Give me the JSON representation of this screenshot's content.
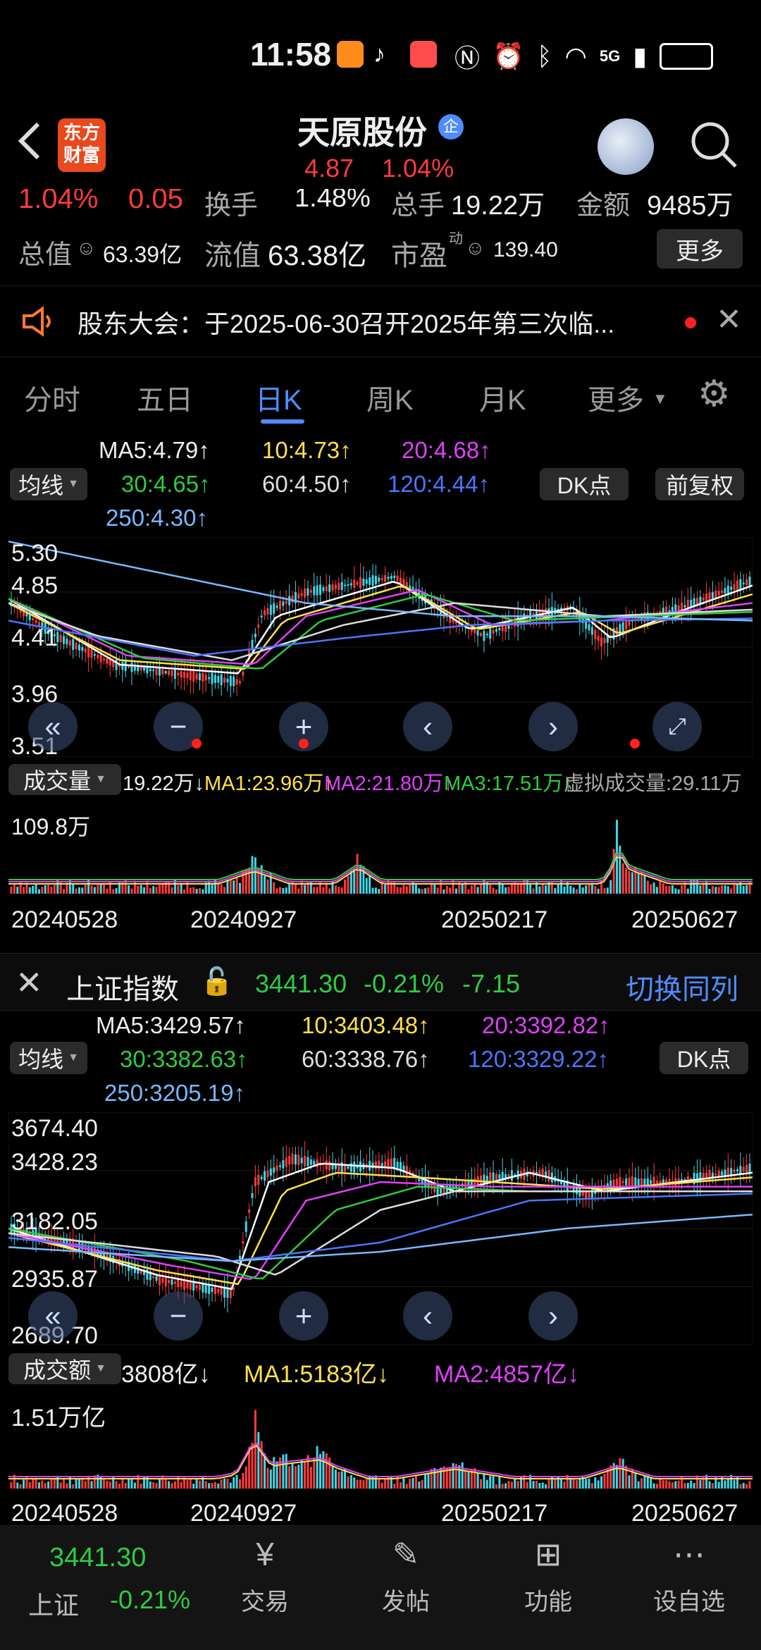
{
  "status_bar": {
    "time": "11:58",
    "network": "5G"
  },
  "header": {
    "app_logo_line1": "东方",
    "app_logo_line2": "财富",
    "stock_name": "天原股份",
    "enterprise_badge": "企",
    "price": "4.87",
    "change_pct": "1.04%"
  },
  "stats": {
    "row1": {
      "pct": "1.04%",
      "change": "0.05",
      "turnover_label": "换手",
      "turnover": "1.48%",
      "volume_label": "总手",
      "volume": "19.22万",
      "amount_label": "金额",
      "amount": "9485万"
    },
    "row2": {
      "total_value_label": "总值",
      "total_value": "63.39亿",
      "float_value_label": "流值",
      "float_value": "63.38亿",
      "pe_label": "市盈",
      "pe_sup": "动",
      "pe": "139.40",
      "more_button": "更多"
    }
  },
  "announcement": {
    "text": "股东大会：于2025-06-30召开2025年第三次临..."
  },
  "tabs": [
    "分时",
    "五日",
    "日K",
    "周K",
    "月K",
    "更多"
  ],
  "active_tab": "日K",
  "chart1": {
    "ma_button": "均线",
    "ma5": "MA5:4.79↑",
    "ma10": "10:4.73↑",
    "ma20": "20:4.68↑",
    "ma30": "30:4.65↑",
    "ma60": "60:4.50↑",
    "ma120": "120:4.44↑",
    "ma250": "250:4.30↑",
    "dk_button": "DK点",
    "adjust_button": "前复权",
    "y_labels": [
      "5.30",
      "4.85",
      "4.41",
      "3.96",
      "3.51"
    ],
    "volume_button": "成交量",
    "vol_now": "19.22万↓",
    "vol_ma1": "MA1:23.96万↑",
    "vol_ma2": "MA2:21.80万↑",
    "vol_ma3": "MA3:17.51万↑",
    "vol_virtual": "虚拟成交量:29.11万",
    "vol_max": "109.8万",
    "dates": [
      "20240528",
      "20240927",
      "20250217",
      "20250627"
    ]
  },
  "index_bar": {
    "name": "上证指数",
    "price": "3441.30",
    "pct": "-0.21%",
    "change": "-7.15",
    "switch_button": "切换同列"
  },
  "chart2": {
    "ma_button": "均线",
    "ma5": "MA5:3429.57↑",
    "ma10": "10:3403.48↑",
    "ma20": "20:3392.82↑",
    "ma30": "30:3382.63↑",
    "ma60": "60:3338.76↑",
    "ma120": "120:3329.22↑",
    "ma250": "250:3205.19↑",
    "dk_button": "DK点",
    "y_labels": [
      "3674.40",
      "3428.23",
      "3182.05",
      "2935.87",
      "2689.70"
    ],
    "amount_button": "成交额",
    "amount_now": "3808亿↓",
    "amount_ma1": "MA1:5183亿↓",
    "amount_ma2": "MA2:4857亿↓",
    "amount_max": "1.51万亿",
    "dates": [
      "20240528",
      "20240927",
      "20250217",
      "20250627"
    ]
  },
  "bottom_nav": {
    "index_price": "3441.30",
    "index_name": "上证",
    "index_pct": "-0.21%",
    "items": [
      "交易",
      "发帖",
      "功能",
      "设自选"
    ]
  },
  "colors": {
    "up": "#ff3b3b",
    "down": "#2ecc40",
    "accent": "#4f8cff",
    "ma5": "#ffffff",
    "ma10": "#ffe14d",
    "ma20": "#e040fb",
    "ma30": "#2ecc40",
    "ma60": "#dddddd",
    "ma120": "#4a76ff",
    "ma250": "#79b8ff"
  }
}
